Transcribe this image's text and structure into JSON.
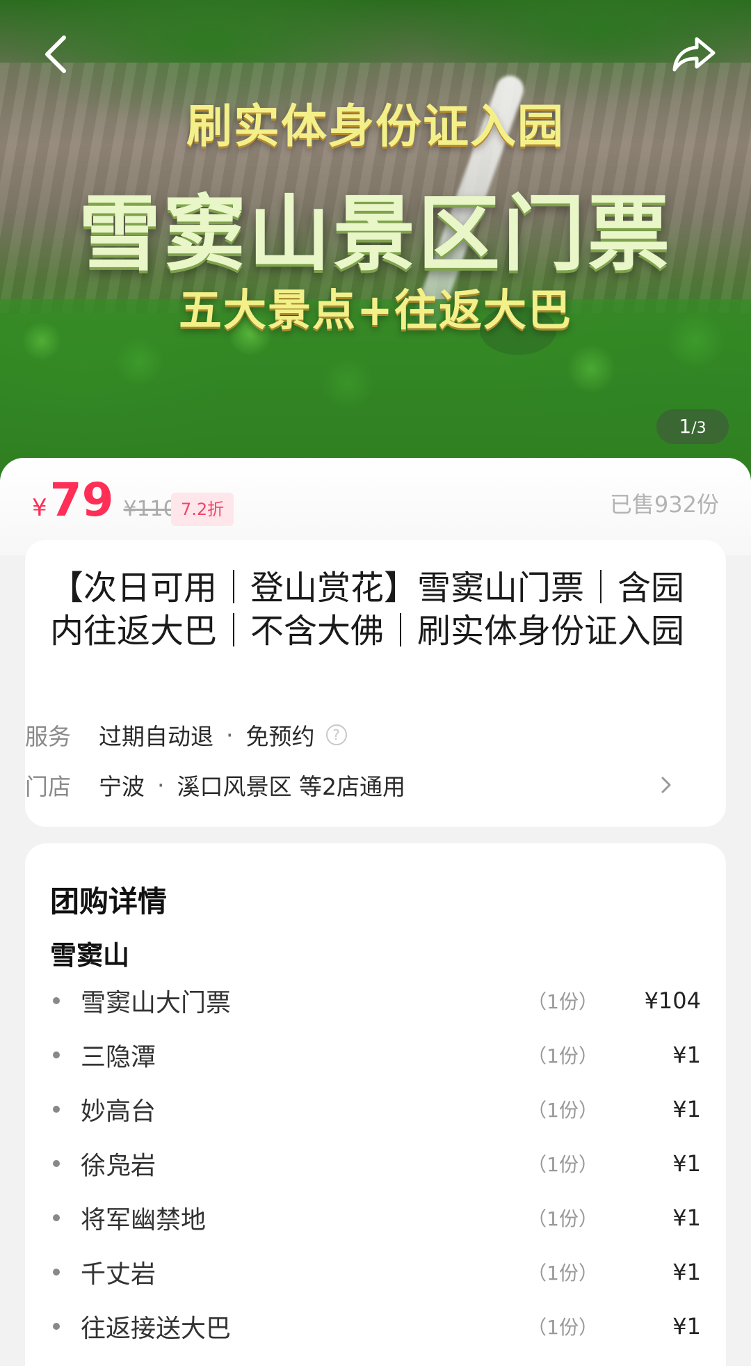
{
  "hero": {
    "subtitle_top": "刷实体身份证入园",
    "title": "雪窦山景区门票",
    "subtitle_bottom": "五大景点+往返大巴",
    "pager_current": "1",
    "pager_total": "/3"
  },
  "price": {
    "currency": "¥",
    "value": "79",
    "original": "¥110",
    "discount": "7.2折",
    "sold": "已售932份",
    "accent_color": "#ff2e57"
  },
  "info": {
    "title": "【次日可用｜登山赏花】雪窦山门票｜含园内往返大巴｜不含大佛｜刷实体身份证入园",
    "service_label": "服务",
    "service_item_1": "过期自动退",
    "service_item_2": "免预约",
    "help_icon": "?",
    "store_label": "门店",
    "store_city": "宁波",
    "store_area": "溪口风景区 等2店通用"
  },
  "details": {
    "section_title": "团购详情",
    "group_name": "雪窦山",
    "items": [
      {
        "name": "雪窦山大门票",
        "qty": "（1份）",
        "price": "¥104"
      },
      {
        "name": "三隐潭",
        "qty": "（1份）",
        "price": "¥1"
      },
      {
        "name": "妙高台",
        "qty": "（1份）",
        "price": "¥1"
      },
      {
        "name": "徐凫岩",
        "qty": "（1份）",
        "price": "¥1"
      },
      {
        "name": "将军幽禁地",
        "qty": "（1份）",
        "price": "¥1"
      },
      {
        "name": "千丈岩",
        "qty": "（1份）",
        "price": "¥1"
      },
      {
        "name": "往返接送大巴",
        "qty": "（1份）",
        "price": "¥1"
      }
    ]
  },
  "icons": {
    "back": "back-arrow-icon",
    "share": "share-icon",
    "chevron": "chevron-right-icon"
  }
}
